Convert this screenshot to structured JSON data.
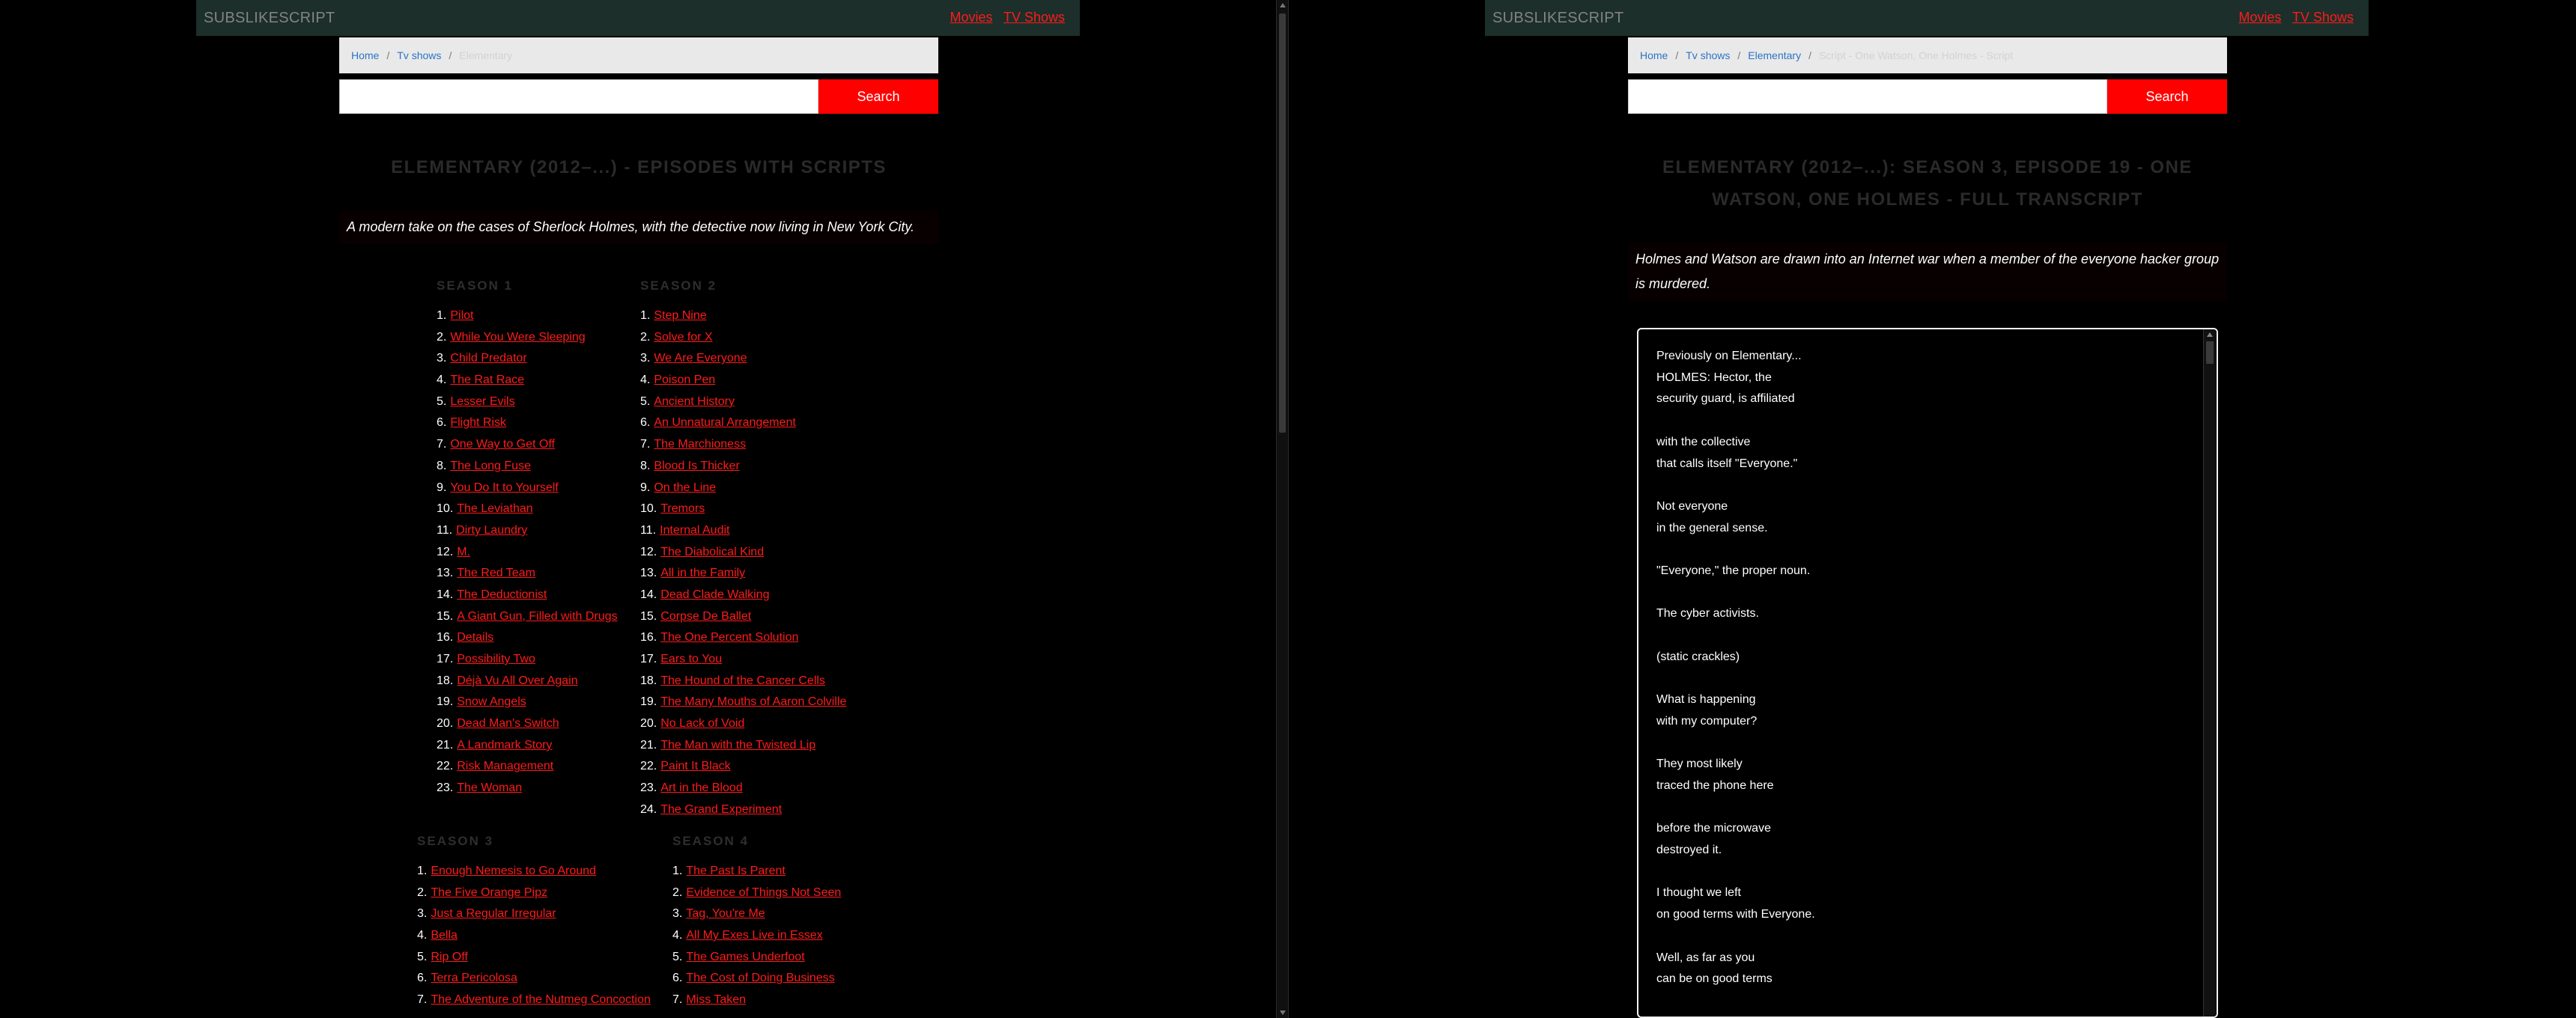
{
  "brand": "SUBSLIKESCRIPT",
  "nav": {
    "movies": "Movies",
    "tv_shows": "TV Shows"
  },
  "search": {
    "button": "Search",
    "placeholder": ""
  },
  "left": {
    "breadcrumb": {
      "home": "Home",
      "tv_shows": "Tv shows",
      "current": "Elementary"
    },
    "title": "ELEMENTARY (2012–...) - EPISODES WITH SCRIPTS",
    "description": "A modern take on the cases of Sherlock Holmes, with the detective now living in New York City.",
    "seasons": [
      {
        "label": "SEASON 1",
        "episodes": [
          "Pilot",
          "While You Were Sleeping",
          "Child Predator",
          "The Rat Race",
          "Lesser Evils",
          "Flight Risk",
          "One Way to Get Off",
          "The Long Fuse",
          "You Do It to Yourself",
          "The Leviathan",
          "Dirty Laundry",
          "M.",
          "The Red Team",
          "The Deductionist",
          "A Giant Gun, Filled with Drugs",
          "Details",
          "Possibility Two",
          "Déjà Vu All Over Again",
          "Snow Angels",
          "Dead Man's Switch",
          "A Landmark Story",
          "Risk Management",
          "The Woman"
        ]
      },
      {
        "label": "SEASON 2",
        "episodes": [
          "Step Nine",
          "Solve for X",
          "We Are Everyone",
          "Poison Pen",
          "Ancient History",
          "An Unnatural Arrangement",
          "The Marchioness",
          "Blood Is Thicker",
          "On the Line",
          "Tremors",
          "Internal Audit",
          "The Diabolical Kind",
          "All in the Family",
          "Dead Clade Walking",
          "Corpse De Ballet",
          "The One Percent Solution",
          "Ears to You",
          "The Hound of the Cancer Cells",
          "The Many Mouths of Aaron Colville",
          "No Lack of Void",
          "The Man with the Twisted Lip",
          "Paint It Black",
          "Art in the Blood",
          "The Grand Experiment"
        ]
      },
      {
        "label": "SEASON 3",
        "episodes": [
          "Enough Nemesis to Go Around",
          "The Five Orange Pipz",
          "Just a Regular Irregular",
          "Bella",
          "Rip Off",
          "Terra Pericolosa",
          "The Adventure of the Nutmeg Concoction"
        ]
      },
      {
        "label": "SEASON 4",
        "episodes": [
          "The Past Is Parent",
          "Evidence of Things Not Seen",
          "Tag, You're Me",
          "All My Exes Live in Essex",
          "The Games Underfoot",
          "The Cost of Doing Business",
          "Miss Taken"
        ]
      }
    ]
  },
  "right": {
    "breadcrumb": {
      "home": "Home",
      "tv_shows": "Tv shows",
      "show": "Elementary",
      "current": "Script - One Watson, One Holmes - Script"
    },
    "title_line1": "ELEMENTARY (2012–...): SEASON 3, EPISODE 19 - ONE",
    "title_line2": "WATSON, ONE HOLMES - FULL TRANSCRIPT",
    "description_line1": "Holmes and Watson are drawn into an Internet war when a member of the everyone hacker group",
    "description_line2": "is murdered.",
    "transcript": [
      "Previously on Elementary...",
      "HOLMES: Hector, the",
      "security guard, is affiliated",
      "",
      "with the collective",
      "that calls itself \"Everyone.\"",
      "",
      "Not everyone",
      "in the general sense.",
      "",
      "\"Everyone,\" the proper noun.",
      "",
      "The cyber activists.",
      "",
      "(static crackles)",
      "",
      "What is happening",
      "with my computer?",
      "",
      "They most likely",
      "traced the phone here",
      "",
      "before the microwave",
      "destroyed it.",
      "",
      "I thought we left",
      "on good terms with Everyone.",
      "",
      "Well, as far as you",
      "can be on good terms"
    ]
  }
}
